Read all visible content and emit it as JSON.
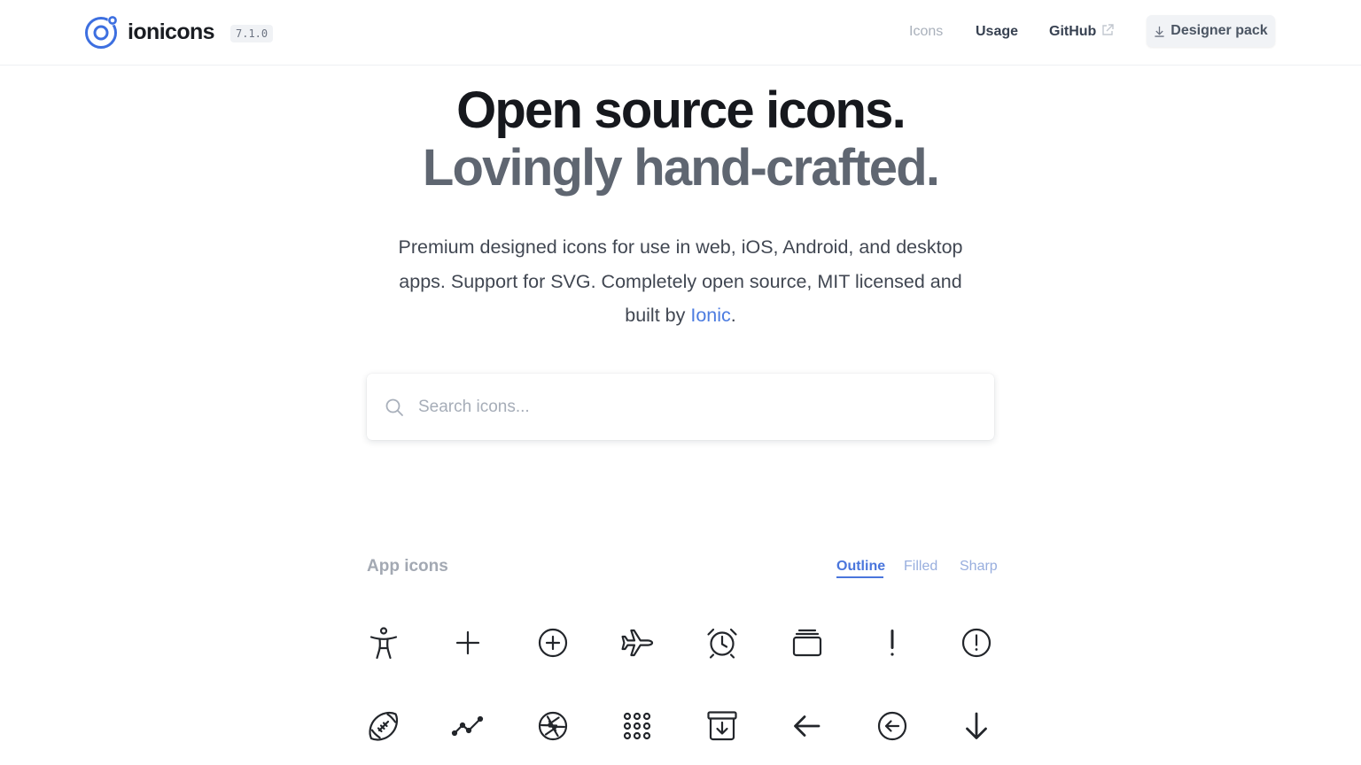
{
  "header": {
    "brand": "ionicons",
    "version": "7.1.0",
    "nav": {
      "icons": "Icons",
      "usage": "Usage",
      "github": "GitHub",
      "designer_pack": "Designer pack"
    }
  },
  "hero": {
    "line1": "Open source icons.",
    "line2": "Lovingly hand-crafted.",
    "subtitle_before": "Premium designed icons for use in web, iOS, Android, and desktop apps. Support for SVG. Completely open source, MIT licensed and built by ",
    "subtitle_link": "Ionic",
    "subtitle_after": "."
  },
  "search": {
    "placeholder": "Search icons..."
  },
  "section": {
    "title": "App icons",
    "tabs": [
      "Outline",
      "Filled",
      "Sharp"
    ],
    "active_tab": "Outline"
  },
  "colors": {
    "accent": "#4a76dc",
    "logo_blue": "#3d6fe0"
  },
  "icons": [
    "accessibility-outline-icon",
    "add-icon",
    "add-circle-outline-icon",
    "airplane-outline-icon",
    "alarm-outline-icon",
    "albums-outline-icon",
    "alert-icon",
    "alert-circle-outline-icon",
    "american-football-outline-icon",
    "analytics-icon",
    "aperture-outline-icon",
    "apps-icon",
    "archive-outline-icon",
    "arrow-back-icon",
    "arrow-back-circle-outline-icon",
    "arrow-down-icon"
  ]
}
